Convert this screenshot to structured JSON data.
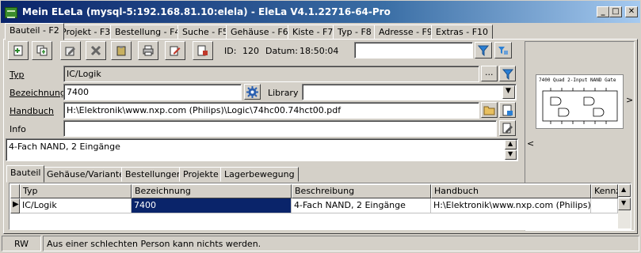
{
  "window": {
    "title": "Mein ELeLa (mysql-5:192.168.81.10:elela) - EleLa V4.1.22716-64-Pro",
    "buttons": {
      "minimize": "_",
      "maximize": "□",
      "close": "✕"
    }
  },
  "main_tabs": [
    "Bauteil - F2",
    "Projekt - F3",
    "Bestellung - F4",
    "Suche - F5",
    "Gehäuse - F6",
    "Kiste - F7",
    "Typ - F8",
    "Adresse - F9",
    "Extras - F10"
  ],
  "toolbar": {
    "id_label": "ID:",
    "id_value": "120",
    "datum_label": "Datum:",
    "datum_value": "18:50:04",
    "search_value": ""
  },
  "form": {
    "typ_label": "Typ",
    "typ_value": "IC/Logik",
    "bezeichnung_label": "Bezeichnung",
    "bezeichnung_value": "7400",
    "library_label": "Library",
    "library_value": "",
    "handbuch_label": "Handbuch",
    "handbuch_value": "H:\\Elektronik\\www.nxp.com (Philips)\\Logic\\74hc00.74hct00.pdf",
    "info_label": "Info",
    "info_value": "",
    "beschreibung_value": "4-Fach NAND, 2 Eingänge",
    "ellipsis": "..."
  },
  "preview": {
    "title": "7400  Quad 2-Input NAND Gate",
    "prev": "<",
    "next": ">"
  },
  "detail_tabs": [
    "Bauteil",
    "Gehäuse/Variante",
    "Bestellungen",
    "Projekte",
    "Lagerbewegung"
  ],
  "grid": {
    "columns": [
      "Typ",
      "Bezeichnung",
      "Beschreibung",
      "Handbuch",
      "Kennz"
    ],
    "rows": [
      [
        "IC/Logik",
        "7400",
        "4-Fach NAND, 2 Eingänge",
        "H:\\Elektronik\\www.nxp.com (Philips)\\Logi",
        ""
      ]
    ]
  },
  "status": {
    "mode": "RW",
    "message": "Aus einer schlechten Person kann nichts werden."
  },
  "colors": {
    "title_bar": "#0a246a",
    "selection": "#0a246a",
    "face": "#d4d0c8",
    "filter_blue": "#2a7fd4"
  }
}
